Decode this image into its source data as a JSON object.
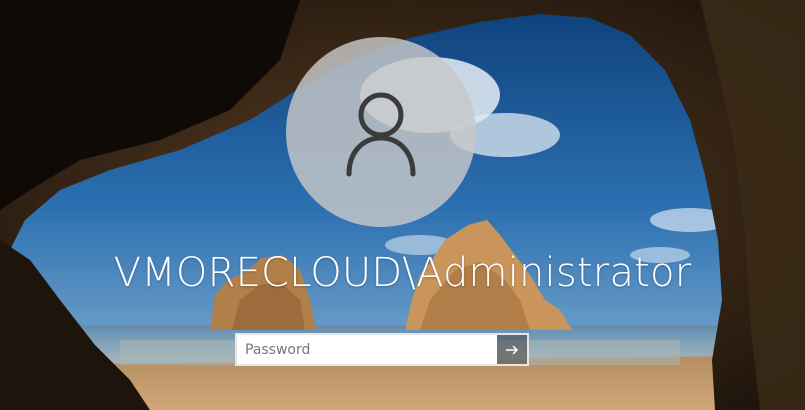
{
  "login": {
    "username": "VMORECLOUD\\Administrator",
    "password_placeholder": "Password",
    "password_value": "",
    "submit_icon": "arrow-right-icon",
    "avatar_icon": "user-icon"
  },
  "colors": {
    "sky": "#1f5f9c",
    "sea": "#3a7fae",
    "sand": "#c59a6a",
    "cave_rock": "#3a2a1a",
    "avatar_bg": "#c8c8c8",
    "text": "#ffffff"
  }
}
